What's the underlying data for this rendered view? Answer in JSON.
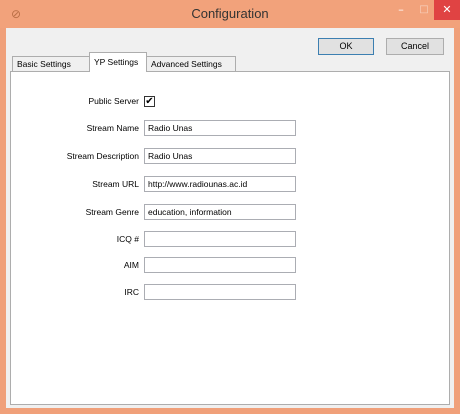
{
  "window": {
    "title": "Configuration",
    "minimize_glyph": "–",
    "maximize_glyph": "□",
    "close_glyph": "✕"
  },
  "buttons": {
    "ok": "OK",
    "cancel": "Cancel"
  },
  "tabs": [
    {
      "label": "Basic Settings",
      "active": false
    },
    {
      "label": "YP Settings",
      "active": true
    },
    {
      "label": "Advanced Settings",
      "active": false
    }
  ],
  "form": {
    "public_server": {
      "label": "Public Server",
      "checked": true,
      "glyph": "✔"
    },
    "stream_name": {
      "label": "Stream Name",
      "value": "Radio Unas"
    },
    "stream_description": {
      "label": "Stream Description",
      "value": "Radio Unas"
    },
    "stream_url": {
      "label": "Stream URL",
      "value": "http://www.radiounas.ac.id"
    },
    "stream_genre": {
      "label": "Stream Genre",
      "value": "education, information"
    },
    "icq": {
      "label": "ICQ #",
      "value": ""
    },
    "aim": {
      "label": "AIM",
      "value": ""
    },
    "irc": {
      "label": "IRC",
      "value": ""
    }
  },
  "colors": {
    "titlebar": "#f2a27b",
    "close_button": "#e04343"
  }
}
